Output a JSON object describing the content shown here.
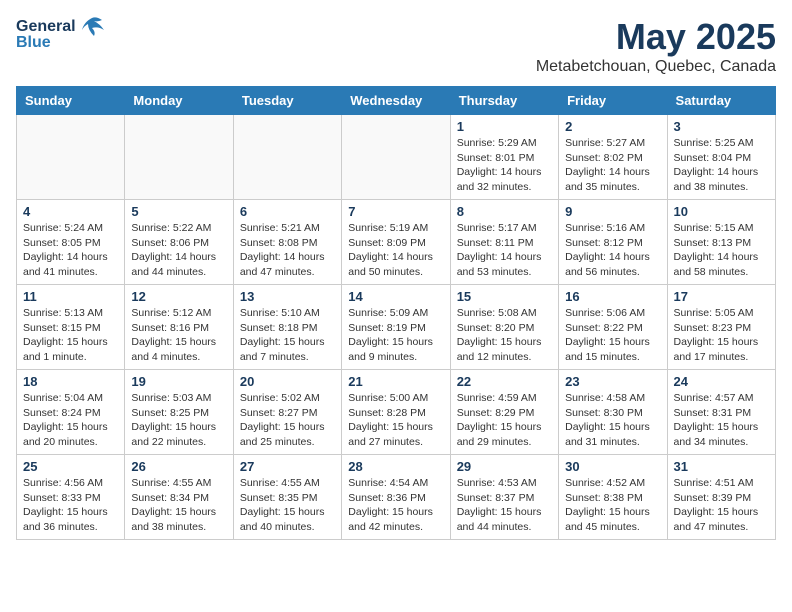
{
  "header": {
    "logo_general": "General",
    "logo_blue": "Blue",
    "title": "May 2025",
    "subtitle": "Metabetchouan, Quebec, Canada"
  },
  "days_of_week": [
    "Sunday",
    "Monday",
    "Tuesday",
    "Wednesday",
    "Thursday",
    "Friday",
    "Saturday"
  ],
  "weeks": [
    [
      {
        "day": "",
        "content": "",
        "empty": true
      },
      {
        "day": "",
        "content": "",
        "empty": true
      },
      {
        "day": "",
        "content": "",
        "empty": true
      },
      {
        "day": "",
        "content": "",
        "empty": true
      },
      {
        "day": "1",
        "content": "Sunrise: 5:29 AM\nSunset: 8:01 PM\nDaylight: 14 hours\nand 32 minutes.",
        "empty": false
      },
      {
        "day": "2",
        "content": "Sunrise: 5:27 AM\nSunset: 8:02 PM\nDaylight: 14 hours\nand 35 minutes.",
        "empty": false
      },
      {
        "day": "3",
        "content": "Sunrise: 5:25 AM\nSunset: 8:04 PM\nDaylight: 14 hours\nand 38 minutes.",
        "empty": false
      }
    ],
    [
      {
        "day": "4",
        "content": "Sunrise: 5:24 AM\nSunset: 8:05 PM\nDaylight: 14 hours\nand 41 minutes.",
        "empty": false
      },
      {
        "day": "5",
        "content": "Sunrise: 5:22 AM\nSunset: 8:06 PM\nDaylight: 14 hours\nand 44 minutes.",
        "empty": false
      },
      {
        "day": "6",
        "content": "Sunrise: 5:21 AM\nSunset: 8:08 PM\nDaylight: 14 hours\nand 47 minutes.",
        "empty": false
      },
      {
        "day": "7",
        "content": "Sunrise: 5:19 AM\nSunset: 8:09 PM\nDaylight: 14 hours\nand 50 minutes.",
        "empty": false
      },
      {
        "day": "8",
        "content": "Sunrise: 5:17 AM\nSunset: 8:11 PM\nDaylight: 14 hours\nand 53 minutes.",
        "empty": false
      },
      {
        "day": "9",
        "content": "Sunrise: 5:16 AM\nSunset: 8:12 PM\nDaylight: 14 hours\nand 56 minutes.",
        "empty": false
      },
      {
        "day": "10",
        "content": "Sunrise: 5:15 AM\nSunset: 8:13 PM\nDaylight: 14 hours\nand 58 minutes.",
        "empty": false
      }
    ],
    [
      {
        "day": "11",
        "content": "Sunrise: 5:13 AM\nSunset: 8:15 PM\nDaylight: 15 hours\nand 1 minute.",
        "empty": false
      },
      {
        "day": "12",
        "content": "Sunrise: 5:12 AM\nSunset: 8:16 PM\nDaylight: 15 hours\nand 4 minutes.",
        "empty": false
      },
      {
        "day": "13",
        "content": "Sunrise: 5:10 AM\nSunset: 8:18 PM\nDaylight: 15 hours\nand 7 minutes.",
        "empty": false
      },
      {
        "day": "14",
        "content": "Sunrise: 5:09 AM\nSunset: 8:19 PM\nDaylight: 15 hours\nand 9 minutes.",
        "empty": false
      },
      {
        "day": "15",
        "content": "Sunrise: 5:08 AM\nSunset: 8:20 PM\nDaylight: 15 hours\nand 12 minutes.",
        "empty": false
      },
      {
        "day": "16",
        "content": "Sunrise: 5:06 AM\nSunset: 8:22 PM\nDaylight: 15 hours\nand 15 minutes.",
        "empty": false
      },
      {
        "day": "17",
        "content": "Sunrise: 5:05 AM\nSunset: 8:23 PM\nDaylight: 15 hours\nand 17 minutes.",
        "empty": false
      }
    ],
    [
      {
        "day": "18",
        "content": "Sunrise: 5:04 AM\nSunset: 8:24 PM\nDaylight: 15 hours\nand 20 minutes.",
        "empty": false
      },
      {
        "day": "19",
        "content": "Sunrise: 5:03 AM\nSunset: 8:25 PM\nDaylight: 15 hours\nand 22 minutes.",
        "empty": false
      },
      {
        "day": "20",
        "content": "Sunrise: 5:02 AM\nSunset: 8:27 PM\nDaylight: 15 hours\nand 25 minutes.",
        "empty": false
      },
      {
        "day": "21",
        "content": "Sunrise: 5:00 AM\nSunset: 8:28 PM\nDaylight: 15 hours\nand 27 minutes.",
        "empty": false
      },
      {
        "day": "22",
        "content": "Sunrise: 4:59 AM\nSunset: 8:29 PM\nDaylight: 15 hours\nand 29 minutes.",
        "empty": false
      },
      {
        "day": "23",
        "content": "Sunrise: 4:58 AM\nSunset: 8:30 PM\nDaylight: 15 hours\nand 31 minutes.",
        "empty": false
      },
      {
        "day": "24",
        "content": "Sunrise: 4:57 AM\nSunset: 8:31 PM\nDaylight: 15 hours\nand 34 minutes.",
        "empty": false
      }
    ],
    [
      {
        "day": "25",
        "content": "Sunrise: 4:56 AM\nSunset: 8:33 PM\nDaylight: 15 hours\nand 36 minutes.",
        "empty": false
      },
      {
        "day": "26",
        "content": "Sunrise: 4:55 AM\nSunset: 8:34 PM\nDaylight: 15 hours\nand 38 minutes.",
        "empty": false
      },
      {
        "day": "27",
        "content": "Sunrise: 4:55 AM\nSunset: 8:35 PM\nDaylight: 15 hours\nand 40 minutes.",
        "empty": false
      },
      {
        "day": "28",
        "content": "Sunrise: 4:54 AM\nSunset: 8:36 PM\nDaylight: 15 hours\nand 42 minutes.",
        "empty": false
      },
      {
        "day": "29",
        "content": "Sunrise: 4:53 AM\nSunset: 8:37 PM\nDaylight: 15 hours\nand 44 minutes.",
        "empty": false
      },
      {
        "day": "30",
        "content": "Sunrise: 4:52 AM\nSunset: 8:38 PM\nDaylight: 15 hours\nand 45 minutes.",
        "empty": false
      },
      {
        "day": "31",
        "content": "Sunrise: 4:51 AM\nSunset: 8:39 PM\nDaylight: 15 hours\nand 47 minutes.",
        "empty": false
      }
    ]
  ]
}
